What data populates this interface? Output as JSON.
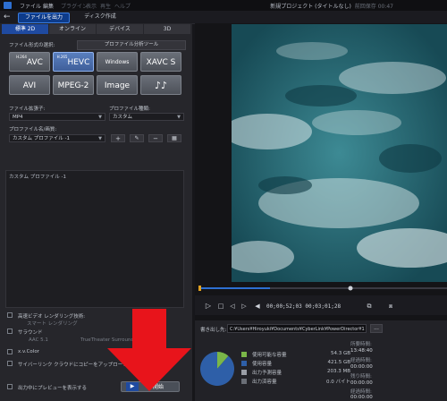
{
  "menubar": {
    "items": [
      "ファイル",
      "編集",
      "プラグイン",
      "表示",
      "再生",
      "ヘルプ"
    ],
    "project_title": "新規プロジェクト (タイトルなし)",
    "project_extra": "前回保存 00:47"
  },
  "modebar": {
    "output_tab": "ファイルを出力",
    "disc_tab": "ディスク作成"
  },
  "subtabs": [
    "標準 2D",
    "オンライン",
    "デバイス",
    "3D"
  ],
  "format_section": {
    "label": "ファイル形式の選択:",
    "profile_tool": "プロファイル分析ツール",
    "buttons": [
      {
        "pre": "H.264",
        "label": "AVC"
      },
      {
        "pre": "H.265",
        "label": "HEVC"
      },
      {
        "pre": "",
        "label": "Windows Media"
      },
      {
        "pre": "",
        "label": "XAVC S"
      },
      {
        "pre": "",
        "label": "AVI"
      },
      {
        "pre": "",
        "label": "MPEG-2"
      },
      {
        "pre": "",
        "label": "Image"
      },
      {
        "pre": "",
        "label": "♪♪"
      }
    ]
  },
  "settings": {
    "ext_label": "ファイル拡張子:",
    "ext_value": "MP4",
    "ptype_label": "プロファイル種類:",
    "ptype_value": "カスタム",
    "pname_label": "プロファイル名/画質:",
    "pname_value": "カスタム プロファイル -1",
    "btn_add": "+",
    "btn_edit": "✎",
    "btn_remove": "−",
    "btn_save": "▦"
  },
  "description": "カスタム プロファイル -1",
  "options": {
    "hq_render": "高速ビデオ レンダリング技術:",
    "smart_render": "スマート レンダリング",
    "surround": "サラウンド",
    "aac": "AAC 5.1",
    "truetheater": "TrueTheater Surround",
    "xvcolor": "x.v.Color",
    "cyberlink_upload": "サイバーリンク クラウドにコピーをアップロード",
    "preview_during": "出力中にプレビューを表示する"
  },
  "start_button": "開始",
  "playback": {
    "timecode": "00;00;52;03  00;03;01;28"
  },
  "info": {
    "folder_label": "書き出し先:",
    "folder_path": "C:¥Users¥Hiroyuki¥Documents¥CyberLink¥PowerDirector¥1",
    "folder_btn": "...",
    "legend": [
      {
        "name": "使用可能な容量",
        "value": "54.3 GB",
        "color": "#7ab648"
      },
      {
        "name": "使用容量",
        "value": "421.5 GB",
        "color": "#2e5fa8"
      },
      {
        "name": "出力予測容量",
        "value": "203.3 MB",
        "color": "#9a9ea6"
      },
      {
        "name": "出力済容量",
        "value": "0.0 バイト",
        "color": "#6a6e76"
      }
    ],
    "stats": [
      {
        "label": "所要時間:",
        "value": "13:48:40"
      },
      {
        "label": "経過時間:",
        "value": "00:00:00"
      },
      {
        "label": "残り時間:",
        "value": "00:00:00"
      },
      {
        "label": "経過時間:",
        "value": "00:00:00"
      }
    ]
  },
  "disk_usage": {
    "free_fraction": 0.114,
    "used_fraction": 0.886
  },
  "colors": {
    "accent": "#1f4aa0",
    "arrow": "#e8141b"
  }
}
